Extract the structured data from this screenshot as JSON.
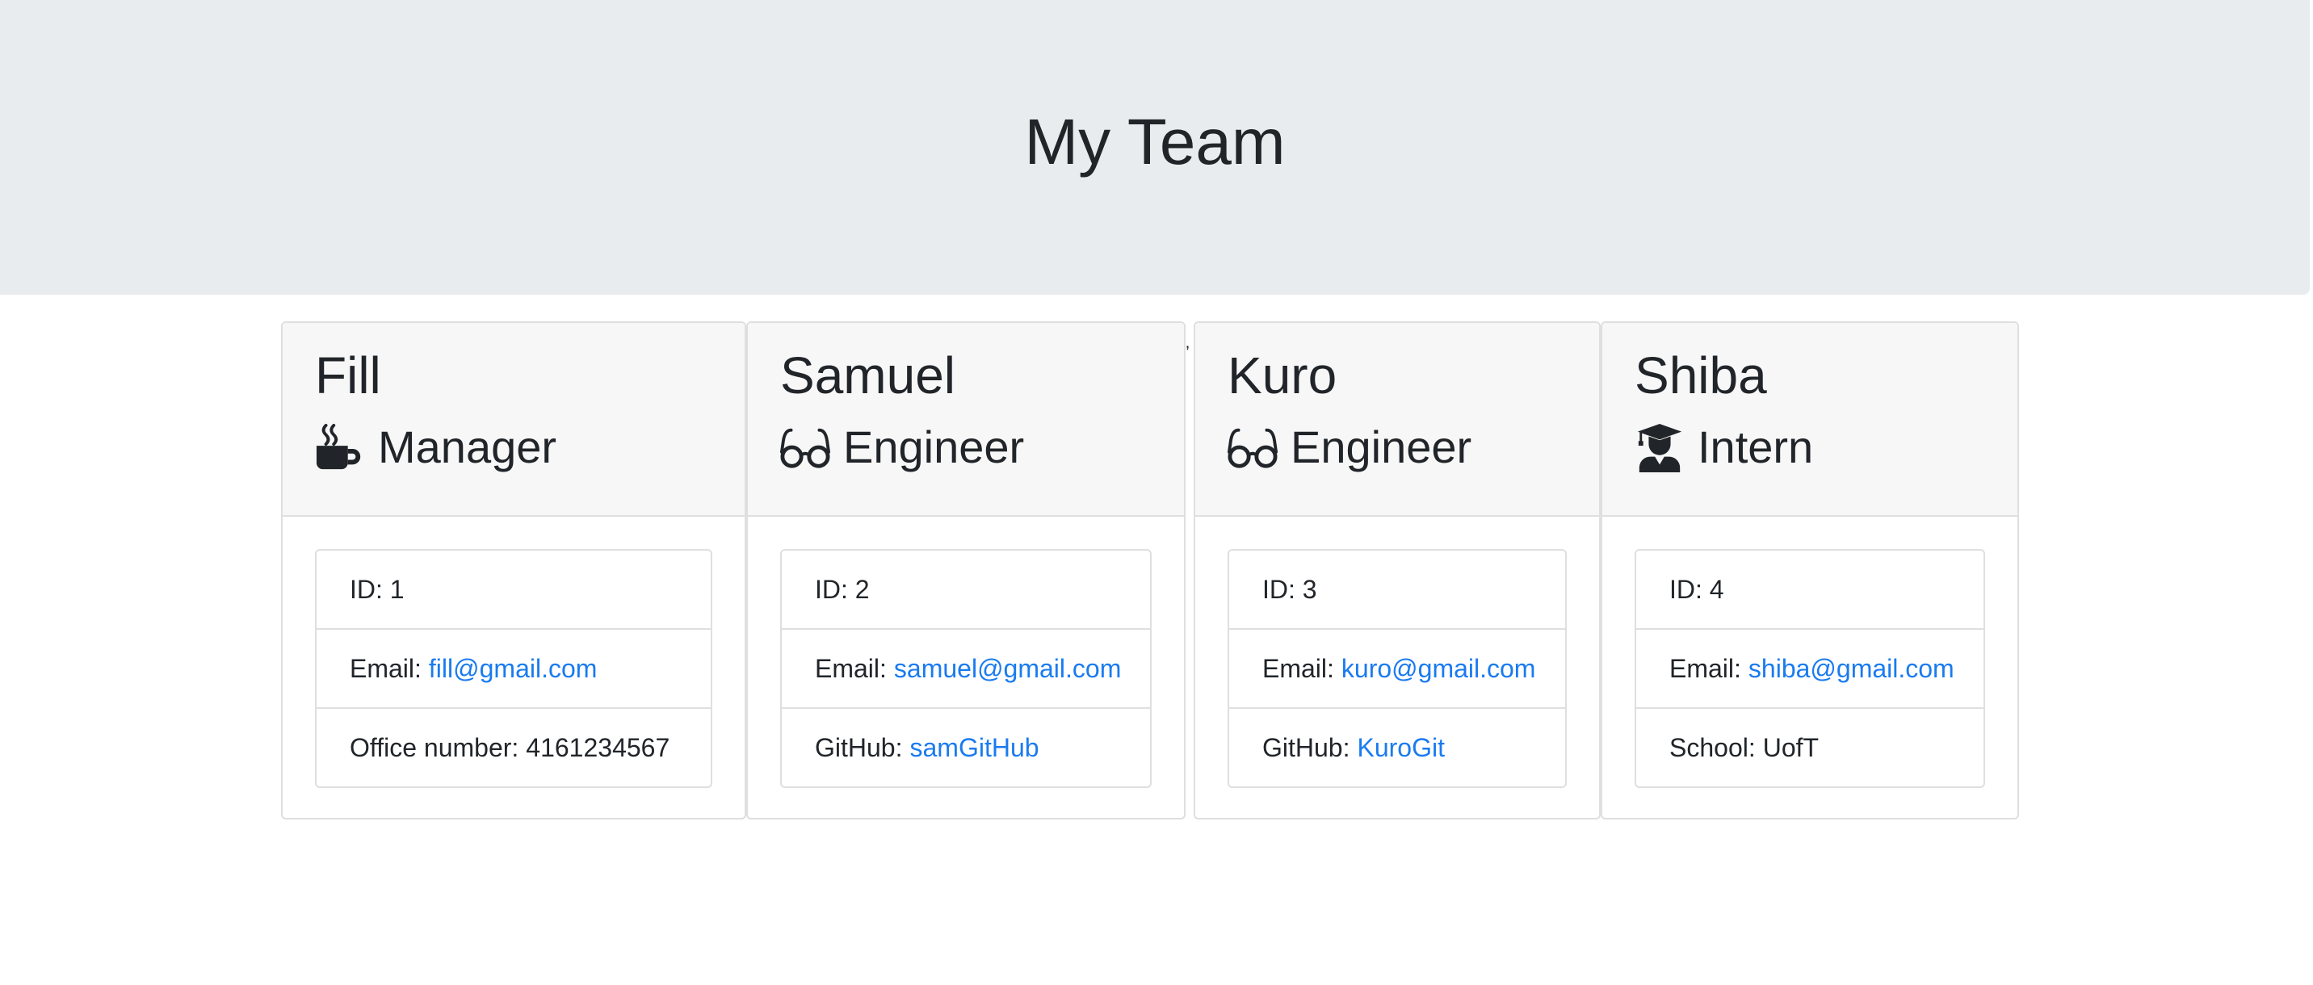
{
  "header": {
    "title": "My Team"
  },
  "stray_mark": "’",
  "colors": {
    "link": "#1a7bf0",
    "jumbotron_bg": "#e9ecef",
    "card_header_bg": "#f7f7f7"
  },
  "team": [
    {
      "name": "Fill",
      "role": "Manager",
      "icon": "mug-hot-icon",
      "id_label": "ID: 1",
      "email_label": "Email:",
      "email": "fill@gmail.com",
      "extra_label": "Office number:",
      "extra_value": "4161234567"
    },
    {
      "name": "Samuel",
      "role": "Engineer",
      "icon": "glasses-icon",
      "id_label": "ID: 2",
      "email_label": "Email:",
      "email": "samuel@gmail.com",
      "extra_label": "GitHub:",
      "extra_value": "samGitHub"
    },
    {
      "name": "Kuro",
      "role": "Engineer",
      "icon": "glasses-icon",
      "id_label": "ID: 3",
      "email_label": "Email:",
      "email": "kuro@gmail.com",
      "extra_label": "GitHub:",
      "extra_value": "KuroGit"
    },
    {
      "name": "Shiba",
      "role": "Intern",
      "icon": "user-graduate-icon",
      "id_label": "ID: 4",
      "email_label": "Email:",
      "email": "shiba@gmail.com",
      "extra_label": "School:",
      "extra_value": "UofT"
    }
  ]
}
